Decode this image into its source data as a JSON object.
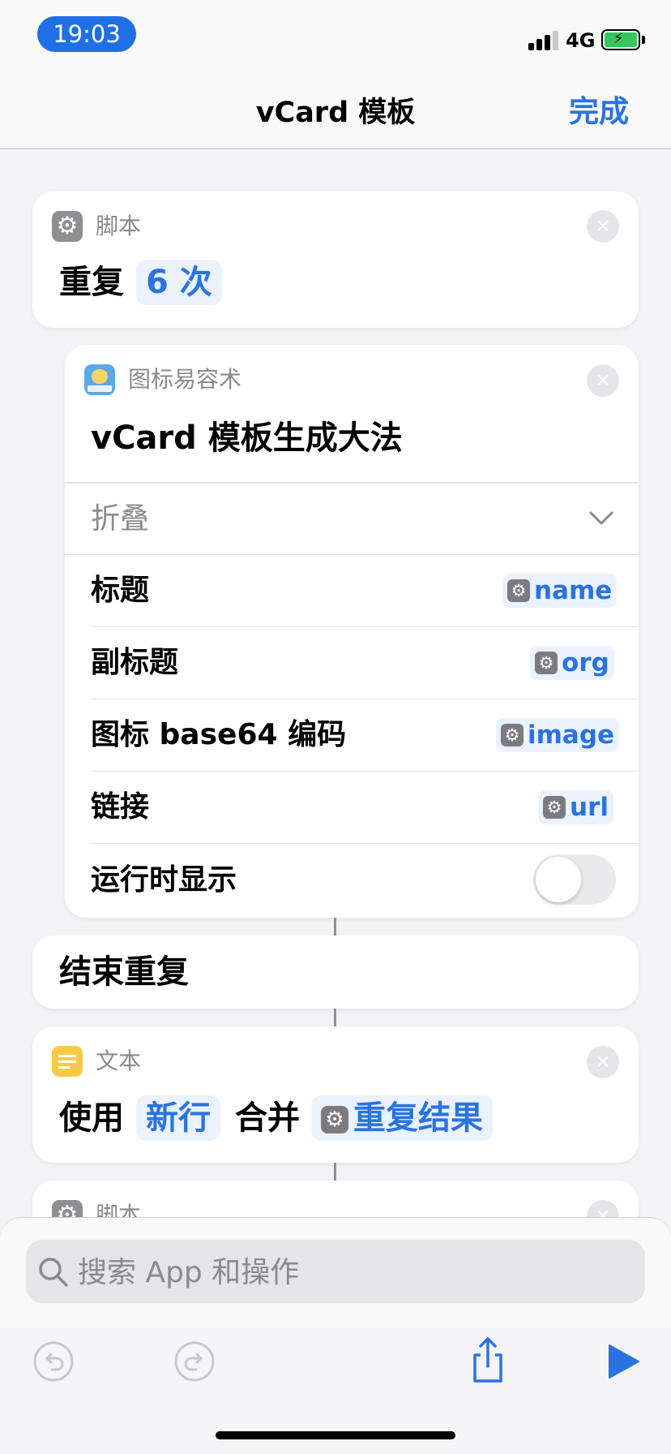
{
  "status_bar": {
    "time": "19:03",
    "network": "4G"
  },
  "nav": {
    "title": "vCard 模板",
    "done": "完成"
  },
  "actions": [
    {
      "category": "脚本",
      "text": "重复",
      "token": "6 次"
    },
    {
      "category": "图标易容术",
      "title": "vCard 模板生成大法",
      "collapse_label": "折叠",
      "params": [
        {
          "label": "标题",
          "value": "name"
        },
        {
          "label": "副标题",
          "value": "org"
        },
        {
          "label": "图标 base64 编码",
          "value": "image"
        },
        {
          "label": "链接",
          "value": "url"
        }
      ],
      "show_when_run_label": "运行时显示",
      "show_when_run": false
    },
    {
      "text": "结束重复"
    },
    {
      "category": "文本",
      "prefix": "使用",
      "token1": "新行",
      "middle": "合并",
      "token2": "重复结果"
    },
    {
      "category": "脚本"
    }
  ],
  "search": {
    "placeholder": "搜索 App 和操作"
  },
  "toolbar": {
    "undo": "undo-icon",
    "redo": "redo-icon",
    "share": "share-icon",
    "run": "play-icon"
  },
  "colors": {
    "accent": "#2a73e0",
    "time_pill": "#1f6fe5",
    "battery": "#35c759"
  }
}
